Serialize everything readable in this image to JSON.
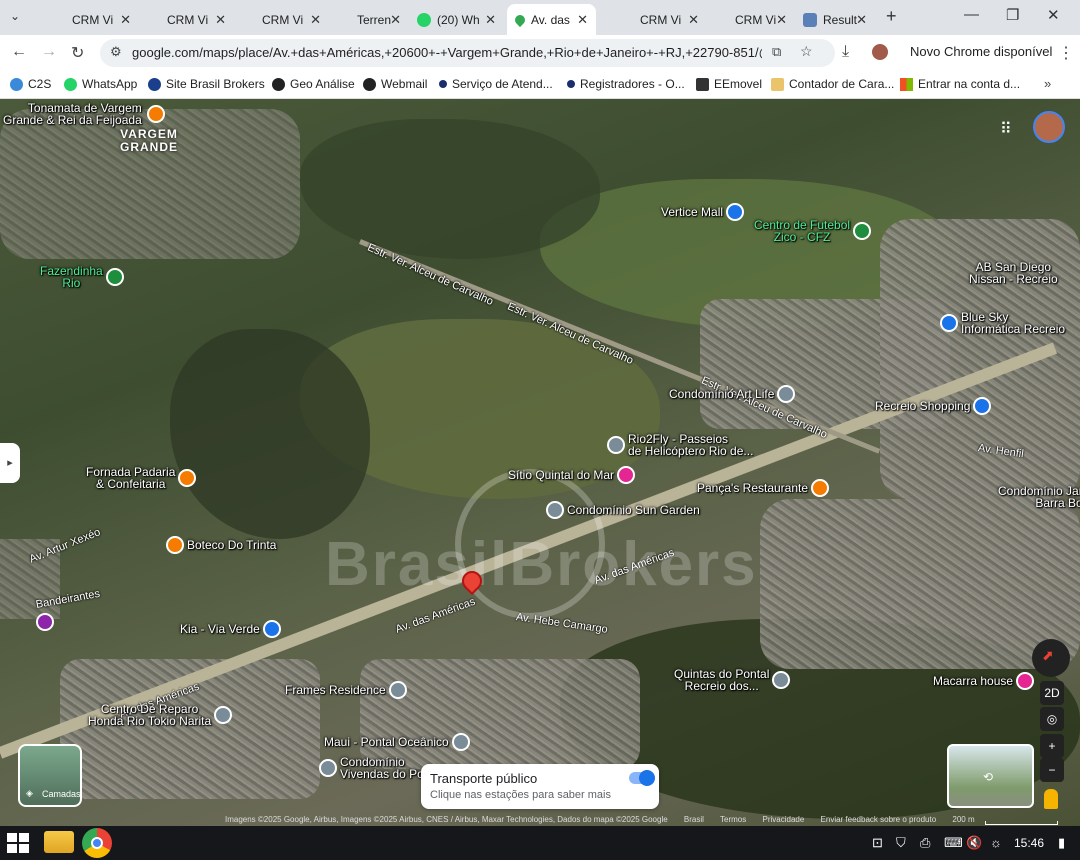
{
  "browser": {
    "tabs": [
      {
        "title": "CRM Vi",
        "active": false
      },
      {
        "title": "CRM Vi",
        "active": false
      },
      {
        "title": "CRM Vi",
        "active": false
      },
      {
        "title": "Terren",
        "active": false
      },
      {
        "title": "(20) Wh",
        "active": false
      },
      {
        "title": "Av. das",
        "active": true
      },
      {
        "title": "CRM Vi",
        "active": false
      },
      {
        "title": "CRM Vi",
        "active": false
      },
      {
        "title": "Result",
        "active": false
      }
    ],
    "url": "google.com/maps/place/Av.+das+Américas,+20600+-+Vargem+Grande,+Rio+de+Janeiro+-+RJ,+22790-851/@-23.036...",
    "update_label": "Novo Chrome disponível",
    "bookmarks": [
      "C2S",
      "WhatsApp",
      "Site Brasil Brokers",
      "Geo Análise",
      "Webmail",
      "Serviço de Atend...",
      "Registradores - O...",
      "EEmovel",
      "Contador de Cara...",
      "Entrar na conta d..."
    ]
  },
  "map": {
    "places": {
      "vargem_grande_1": "VARGEM",
      "vargem_grande_2": "GRANDE",
      "tonamata_1": "Tonamata de Vargem",
      "tonamata_2": "Grande & Rei da Feijoada"
    },
    "roads": {
      "estr_alceu_1": "Estr. Ver. Alceu de Carvalho",
      "estr_alceu_2": "Estr. Ver. Alceu de Carvalho",
      "estr_alceu_3": "Estr. Ver. Alceu de Carvalho",
      "av_americas_1": "Av. das Américas",
      "av_americas_2": "Av. das Américas",
      "av_americas_3": "Av. das Américas",
      "av_hebe": "Av. Hebe Camargo",
      "av_artur": "Av. Artur Xexéo",
      "bandeirantes": "Bandeirantes",
      "av_henfil": "Av. Henfil"
    },
    "pois": {
      "vertice": "Vertice Mall",
      "zico_1": "Centro de Futebol",
      "zico_2": "Zico - CFZ",
      "fazendinha_1": "Fazendinha",
      "fazendinha_2": "Rio",
      "ab_1": "AB San Diego",
      "ab_2": "Nissan - Recreio",
      "bluesky_1": "Blue Sky",
      "bluesky_2": "Informática Recreio",
      "artlife": "Condomínio Art Life",
      "recreio_shopping": "Recreio Shopping",
      "rio2fly_1": "Rio2Fly - Passeios",
      "rio2fly_2": "de Helicóptero Rio de...",
      "sitio": "Sítio Quintal do Mar",
      "pancas": "Pança's Restaurante",
      "condjar_1": "Condomínio Jar",
      "condjar_2": "Barra Bo",
      "fornada_1": "Fornada Padaria",
      "fornada_2": "& Confeitaria",
      "sungarden": "Condomínio Sun Garden",
      "boteco": "Boteco Do Trinta",
      "kia": "Kia - Via Verde",
      "quintas_1": "Quintas do Pontal",
      "quintas_2": "Recreio dos...",
      "macarra": "Macarra house",
      "frames": "Frames Residence",
      "centro_1": "Centro De Reparo",
      "centro_2": "Honda Rio Tokio Narita",
      "maui": "Maui - Pontal Oceânico",
      "vivendas_1": "Condomínio",
      "vivendas_2": "Vivendas do Po"
    },
    "watermark": "BrasilBrokers",
    "layers_label": "Camadas",
    "transit_title": "Transporte público",
    "transit_sub": "Clique nas estações para saber mais",
    "view_mode": "2D",
    "zoom_in": "+",
    "zoom_out": "−",
    "attribution": [
      "Imagens ©2025 Google, Airbus, Imagens ©2025 Airbus, CNES / Airbus, Maxar Technologies, Dados do mapa ©2025 Google",
      "Brasil",
      "Termos",
      "Privacidade",
      "Enviar feedback sobre o produto",
      "200 m"
    ]
  },
  "taskbar": {
    "clock": "15:46"
  },
  "colors": {
    "poi_blue": "#1a73e8",
    "poi_orange": "#f57c00",
    "poi_gray": "#7b8c99",
    "poi_pink": "#e52592",
    "poi_green": "#1e8e3e",
    "poi_purple": "#8e24aa",
    "pin_red": "#ea4335"
  }
}
